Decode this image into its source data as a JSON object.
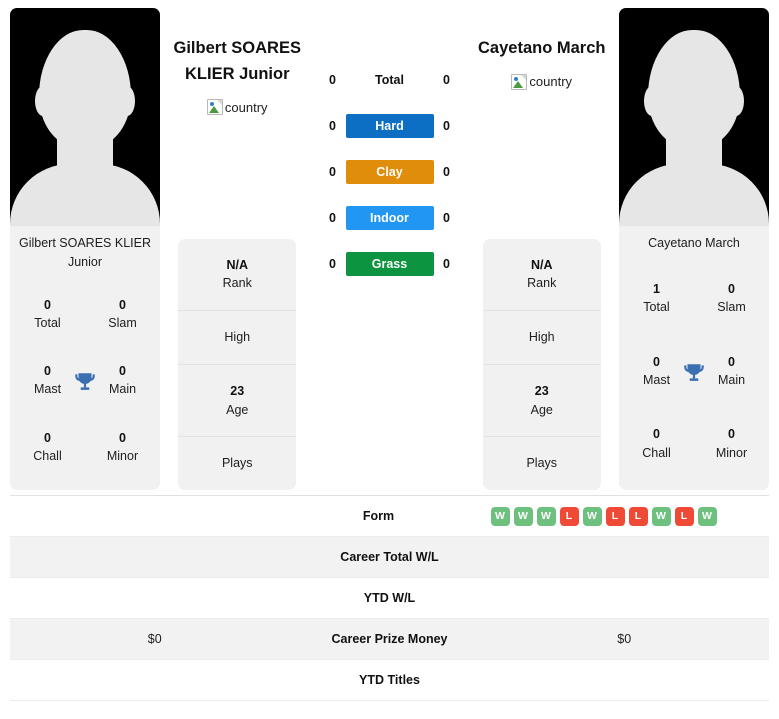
{
  "players": {
    "left": {
      "display_name": "Gilbert SOARES KLIER Junior",
      "card_name": "Gilbert SOARES KLIER Junior",
      "country_alt": "country",
      "rank": "N/A",
      "rank_label": "Rank",
      "high_label": "High",
      "high_value": "",
      "age": "23",
      "age_label": "Age",
      "plays_label": "Plays",
      "plays_value": "",
      "titles": [
        {
          "value": "0",
          "label": "Total"
        },
        {
          "value": "0",
          "label": "Slam"
        },
        {
          "value": "0",
          "label": "Mast"
        },
        {
          "value": "0",
          "label": "Main"
        },
        {
          "value": "0",
          "label": "Chall"
        },
        {
          "value": "0",
          "label": "Minor"
        }
      ]
    },
    "right": {
      "display_name": "Cayetano March",
      "card_name": "Cayetano March",
      "country_alt": "country",
      "rank": "N/A",
      "rank_label": "Rank",
      "high_label": "High",
      "high_value": "",
      "age": "23",
      "age_label": "Age",
      "plays_label": "Plays",
      "plays_value": "",
      "titles": [
        {
          "value": "1",
          "label": "Total"
        },
        {
          "value": "0",
          "label": "Slam"
        },
        {
          "value": "0",
          "label": "Mast"
        },
        {
          "value": "0",
          "label": "Main"
        },
        {
          "value": "0",
          "label": "Chall"
        },
        {
          "value": "0",
          "label": "Minor"
        }
      ]
    }
  },
  "surfaces": [
    {
      "label": "Total",
      "left": "0",
      "right": "0",
      "color": "transparent",
      "plain": true
    },
    {
      "label": "Hard",
      "left": "0",
      "right": "0",
      "color": "#0c6fc4",
      "plain": false
    },
    {
      "label": "Clay",
      "left": "0",
      "right": "0",
      "color": "#e08d0b",
      "plain": false
    },
    {
      "label": "Indoor",
      "left": "0",
      "right": "0",
      "color": "#2196f3",
      "plain": false
    },
    {
      "label": "Grass",
      "left": "0",
      "right": "0",
      "color": "#0d9440",
      "plain": false
    }
  ],
  "comparison_rows": [
    {
      "label": "Form",
      "left": "",
      "right": "",
      "right_is_form": true,
      "form": [
        "W",
        "W",
        "W",
        "L",
        "W",
        "L",
        "L",
        "W",
        "L",
        "W"
      ]
    },
    {
      "label": "Career Total W/L",
      "left": "",
      "right": "",
      "right_is_form": false
    },
    {
      "label": "YTD W/L",
      "left": "",
      "right": "",
      "right_is_form": false
    },
    {
      "label": "Career Prize Money",
      "left": "$0",
      "right": "$0",
      "right_is_form": false
    },
    {
      "label": "YTD Titles",
      "left": "",
      "right": "",
      "right_is_form": false
    }
  ],
  "colors": {
    "win_badge": "#6ec07e",
    "loss_badge": "#ef4a36",
    "trophy": "#3a6fb0",
    "card_bg": "#f1f1f1",
    "row_alt_bg": "#f2f2f2"
  },
  "icons": {
    "trophy": "trophy-icon",
    "broken_image": "broken-image-icon"
  }
}
